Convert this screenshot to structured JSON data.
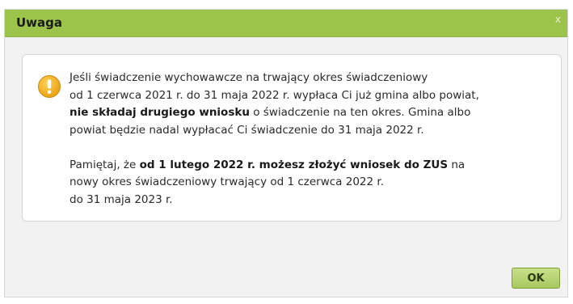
{
  "dialog": {
    "title": "Uwaga",
    "close_label": "x",
    "ok_label": "OK",
    "icon": "exclamation-icon",
    "accent_color": "#9cc34a",
    "paragraph1": [
      [
        "Jeśli świadczenie wychowawcze na trwający okres świadczeniowy"
      ],
      [
        "od 1 czerwca 2021 r. do 31 maja 2022 r. wypłaca Ci już gmina albo powiat,"
      ],
      [
        "nie składaj drugiego wniosku",
        " o świadczenie na ten okres. Gmina albo"
      ],
      [
        "powiat będzie nadal wypłacać Ci świadczenie do 31 maja 2022 r."
      ]
    ],
    "paragraph2": [
      [
        "Pamiętaj, że ",
        "od 1 lutego 2022 r. możesz złożyć wniosek do ZUS",
        " na"
      ],
      [
        "nowy okres świadczeniowy trwający od 1 czerwca 2022 r."
      ],
      [
        "do 31 maja 2023 r."
      ]
    ]
  }
}
